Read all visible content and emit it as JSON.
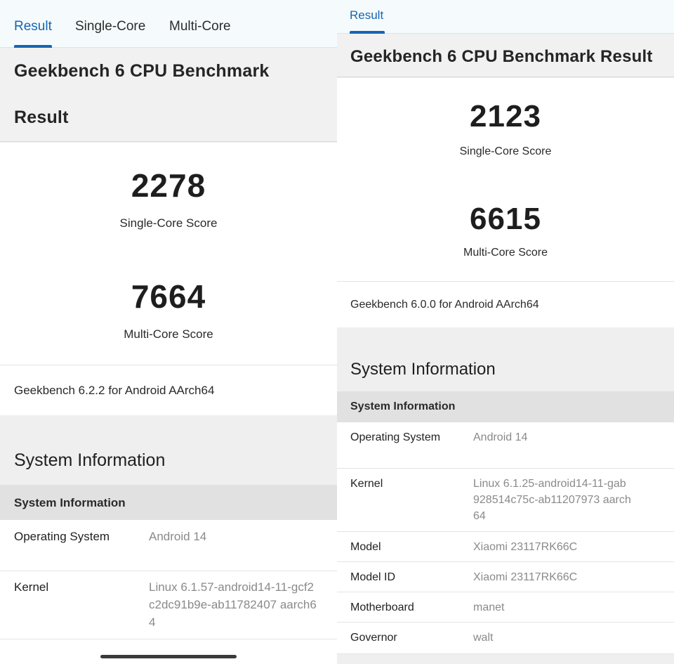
{
  "left": {
    "tabs": [
      {
        "label": "Result",
        "active": true
      },
      {
        "label": "Single-Core",
        "active": false
      },
      {
        "label": "Multi-Core",
        "active": false
      }
    ],
    "title_line1": "Geekbench 6 CPU Benchmark",
    "title_line2": "Result",
    "single_core_score": "2278",
    "single_core_label": "Single-Core Score",
    "multi_core_score": "7664",
    "multi_core_label": "Multi-Core Score",
    "version": "Geekbench 6.2.2 for Android AArch64",
    "section_title": "System Information",
    "sub_header": "System Information",
    "rows": [
      {
        "label": "Operating System",
        "value": "Android 14"
      },
      {
        "label": "Kernel",
        "value": "Linux 6.1.57-android14-11-gcf2c2dc91b9e-ab11782407 aarch64"
      }
    ]
  },
  "right": {
    "tabs": [
      {
        "label": "Result",
        "active": true
      }
    ],
    "title": "Geekbench 6 CPU Benchmark Result",
    "single_core_score": "2123",
    "single_core_label": "Single-Core Score",
    "multi_core_score": "6615",
    "multi_core_label": "Multi-Core Score",
    "version": "Geekbench 6.0.0 for Android AArch64",
    "section_title": "System Information",
    "sub_header": "System Information",
    "rows": [
      {
        "label": "Operating System",
        "value": "Android 14"
      },
      {
        "label": "Kernel",
        "value": "Linux 6.1.25-android14-11-gab928514c75c-ab11207973 aarch64"
      },
      {
        "label": "Model",
        "value": "Xiaomi 23117RK66C"
      },
      {
        "label": "Model ID",
        "value": "Xiaomi 23117RK66C"
      },
      {
        "label": "Motherboard",
        "value": "manet"
      },
      {
        "label": "Governor",
        "value": "walt"
      }
    ]
  },
  "colors": {
    "accent": "#1565b4",
    "value_text": "#8a8a8a",
    "sub_header_bg": "#e1e1e1"
  }
}
